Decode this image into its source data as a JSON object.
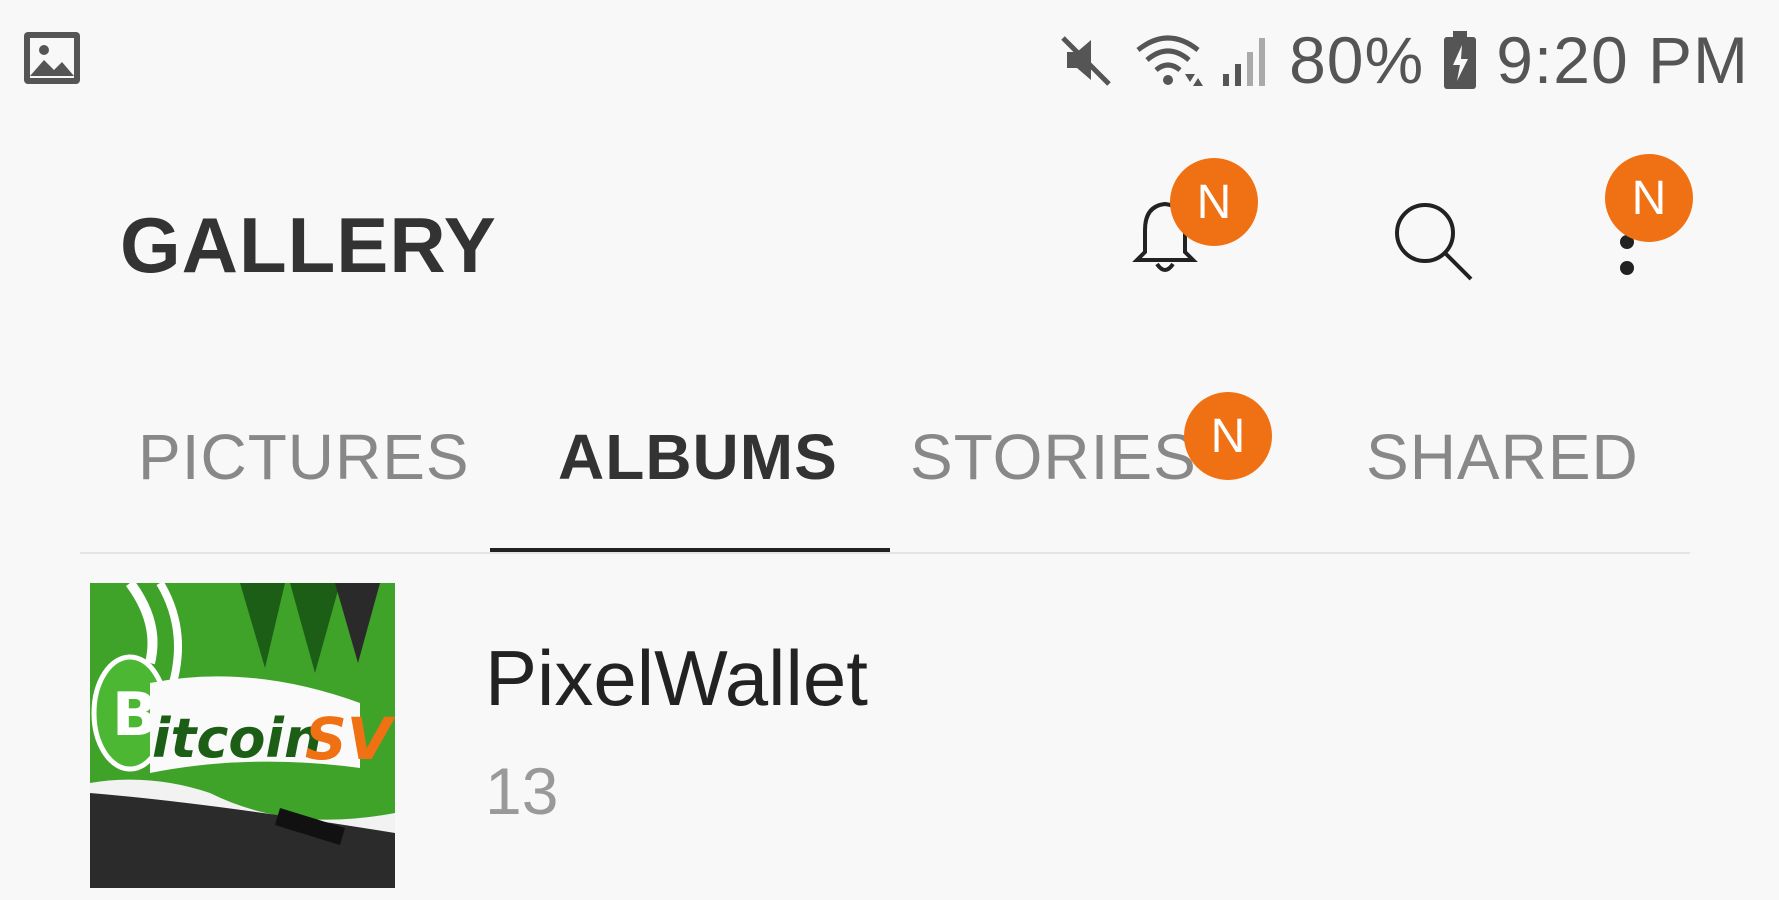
{
  "status_bar": {
    "left_icon": "gallery-notification-icon",
    "icons": [
      "mute-icon",
      "wifi-icon",
      "signal-icon",
      "battery-charging-icon"
    ],
    "battery": "80%",
    "time": "9:20 PM"
  },
  "app_bar": {
    "title": "GALLERY",
    "notification_badge": "N",
    "more_badge": "N",
    "icons": [
      "bell-icon",
      "search-icon",
      "more-vert-icon"
    ]
  },
  "tabs": [
    {
      "label": "PICTURES",
      "active": false
    },
    {
      "label": "ALBUMS",
      "active": true
    },
    {
      "label": "STORIES",
      "active": false,
      "badge": "N"
    },
    {
      "label": "SHARED",
      "active": false
    }
  ],
  "albums": [
    {
      "name": "PixelWallet",
      "count": "13",
      "thumbnail": {
        "text_main": "itcoin",
        "text_sv": "SV"
      }
    }
  ],
  "colors": {
    "accent": "#f07113",
    "background": "#f8f8f8",
    "thumb_green": "#3fa32a"
  }
}
